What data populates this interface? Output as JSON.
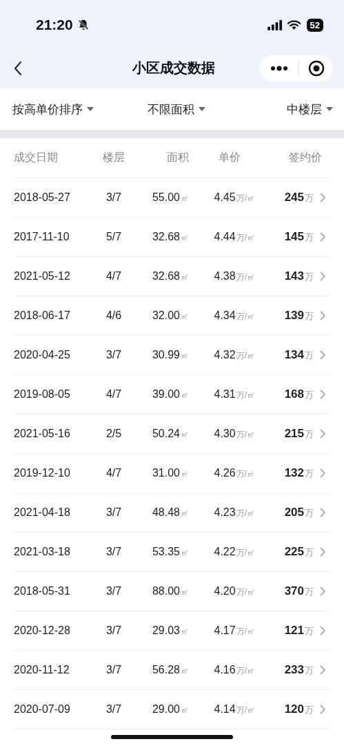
{
  "status_bar": {
    "time": "21:20",
    "battery": "52"
  },
  "nav": {
    "title": "小区成交数据"
  },
  "filters": [
    {
      "label": "按高单价排序"
    },
    {
      "label": "不限面积"
    },
    {
      "label": "中楼层"
    }
  ],
  "table": {
    "columns": [
      "成交日期",
      "楼层",
      "面积",
      "单价",
      "签约价"
    ],
    "rows": [
      {
        "date": "2018-05-27",
        "floor": "3/7",
        "area": "55.00",
        "area_unit": "㎡",
        "unit_price": "4.45",
        "price_unit": "万/㎡",
        "total": "245",
        "total_unit": "万"
      },
      {
        "date": "2017-11-10",
        "floor": "5/7",
        "area": "32.68",
        "area_unit": "㎡",
        "unit_price": "4.44",
        "price_unit": "万/㎡",
        "total": "145",
        "total_unit": "万"
      },
      {
        "date": "2021-05-12",
        "floor": "4/7",
        "area": "32.68",
        "area_unit": "㎡",
        "unit_price": "4.38",
        "price_unit": "万/㎡",
        "total": "143",
        "total_unit": "万"
      },
      {
        "date": "2018-06-17",
        "floor": "4/6",
        "area": "32.00",
        "area_unit": "㎡",
        "unit_price": "4.34",
        "price_unit": "万/㎡",
        "total": "139",
        "total_unit": "万"
      },
      {
        "date": "2020-04-25",
        "floor": "3/7",
        "area": "30.99",
        "area_unit": "㎡",
        "unit_price": "4.32",
        "price_unit": "万/㎡",
        "total": "134",
        "total_unit": "万"
      },
      {
        "date": "2019-08-05",
        "floor": "4/7",
        "area": "39.00",
        "area_unit": "㎡",
        "unit_price": "4.31",
        "price_unit": "万/㎡",
        "total": "168",
        "total_unit": "万"
      },
      {
        "date": "2021-05-16",
        "floor": "2/5",
        "area": "50.24",
        "area_unit": "㎡",
        "unit_price": "4.30",
        "price_unit": "万/㎡",
        "total": "215",
        "total_unit": "万"
      },
      {
        "date": "2019-12-10",
        "floor": "4/7",
        "area": "31.00",
        "area_unit": "㎡",
        "unit_price": "4.26",
        "price_unit": "万/㎡",
        "total": "132",
        "total_unit": "万"
      },
      {
        "date": "2021-04-18",
        "floor": "3/7",
        "area": "48.48",
        "area_unit": "㎡",
        "unit_price": "4.23",
        "price_unit": "万/㎡",
        "total": "205",
        "total_unit": "万"
      },
      {
        "date": "2021-03-18",
        "floor": "3/7",
        "area": "53.35",
        "area_unit": "㎡",
        "unit_price": "4.22",
        "price_unit": "万/㎡",
        "total": "225",
        "total_unit": "万"
      },
      {
        "date": "2018-05-31",
        "floor": "3/7",
        "area": "88.00",
        "area_unit": "㎡",
        "unit_price": "4.20",
        "price_unit": "万/㎡",
        "total": "370",
        "total_unit": "万"
      },
      {
        "date": "2020-12-28",
        "floor": "3/7",
        "area": "29.03",
        "area_unit": "㎡",
        "unit_price": "4.17",
        "price_unit": "万/㎡",
        "total": "121",
        "total_unit": "万"
      },
      {
        "date": "2020-11-12",
        "floor": "3/7",
        "area": "56.28",
        "area_unit": "㎡",
        "unit_price": "4.16",
        "price_unit": "万/㎡",
        "total": "233",
        "total_unit": "万"
      },
      {
        "date": "2020-07-09",
        "floor": "3/7",
        "area": "29.00",
        "area_unit": "㎡",
        "unit_price": "4.14",
        "price_unit": "万/㎡",
        "total": "120",
        "total_unit": "万"
      }
    ]
  }
}
